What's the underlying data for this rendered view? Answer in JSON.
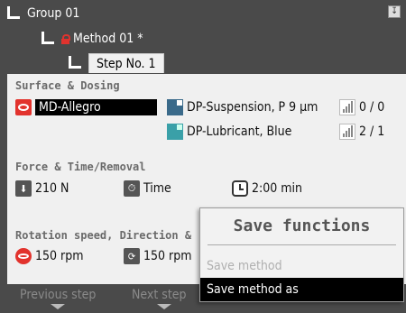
{
  "tree": {
    "group": "Group 01",
    "method": "Method 01 *",
    "step_tab": "Step No. 1"
  },
  "surface_dosing": {
    "title": "Surface & Dosing",
    "surface": "MD-Allegro",
    "suspension": "DP-Suspension, P 9 µm",
    "suspension_level": "0 / 0",
    "lubricant": "DP-Lubricant, Blue",
    "lubricant_level": "2 / 1"
  },
  "force_time": {
    "title": "Force & Time/Removal",
    "force": "210 N",
    "mode": "Time",
    "time": "2:00 min"
  },
  "rotation": {
    "title": "Rotation speed, Direction &",
    "disc_speed": "150 rpm",
    "holder_speed": "150 rpm"
  },
  "bottom_nav": {
    "previous": "Previous step",
    "next": "Next step"
  },
  "popup": {
    "title": "Save functions",
    "items": [
      "Save method",
      "Save method as"
    ],
    "selected_index": 1
  },
  "colors": {
    "accent_red": "#e2332d",
    "background_dark": "#4a4a4a",
    "panel": "#f0f0f0"
  }
}
